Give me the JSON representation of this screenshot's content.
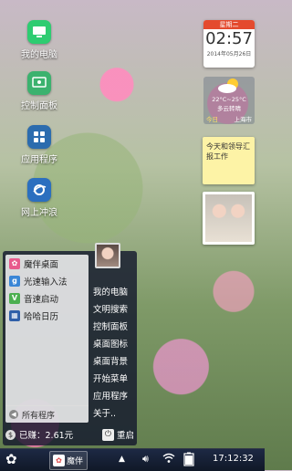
{
  "desktop": {
    "icons": [
      {
        "label": "我的电脑",
        "icon": "computer-icon",
        "color": "#2ecc71"
      },
      {
        "label": "控制面板",
        "icon": "control-panel-icon",
        "color": "#3bb26e"
      },
      {
        "label": "应用程序",
        "icon": "apps-grid-icon",
        "color": "#2c6cae"
      },
      {
        "label": "网上冲浪",
        "icon": "browser-icon",
        "color": "#2b6fbf"
      }
    ]
  },
  "widgets": {
    "clock": {
      "weekday": "星期二",
      "time": "02:57",
      "date": "2014年05月26日"
    },
    "weather": {
      "temp": "22°C~25°C",
      "condition": "多云转晴",
      "day": "今日",
      "city": "上海市"
    },
    "note": {
      "text": "今天和领导汇报工作"
    }
  },
  "start_menu": {
    "apps": [
      {
        "label": "魔伴桌面",
        "icon": "magic-desktop-icon",
        "color": "#e85a8c"
      },
      {
        "label": "光速输入法",
        "icon": "input-method-icon",
        "color": "#3a86d6"
      },
      {
        "label": "音速启动",
        "icon": "launcher-icon",
        "color": "#4caf50"
      },
      {
        "label": "哈哈日历",
        "icon": "calendar-icon",
        "color": "#2f5fa8"
      }
    ],
    "all_programs": "所有程序",
    "right_links": [
      "我的电脑",
      "文明搜索",
      "控制面板",
      "桌面图标",
      "桌面背景",
      "开始菜单",
      "应用程序",
      "关于.."
    ],
    "earnings": "已赚：2.61元",
    "restart": "重启"
  },
  "taskbar": {
    "app_label": "魔伴",
    "clock": "17:12:32"
  },
  "colors": {
    "start_menu_bg": "#141a2d",
    "taskbar_bg": "#101827",
    "clock_header": "#e44a2e",
    "note_bg": "#fdf3a6"
  }
}
